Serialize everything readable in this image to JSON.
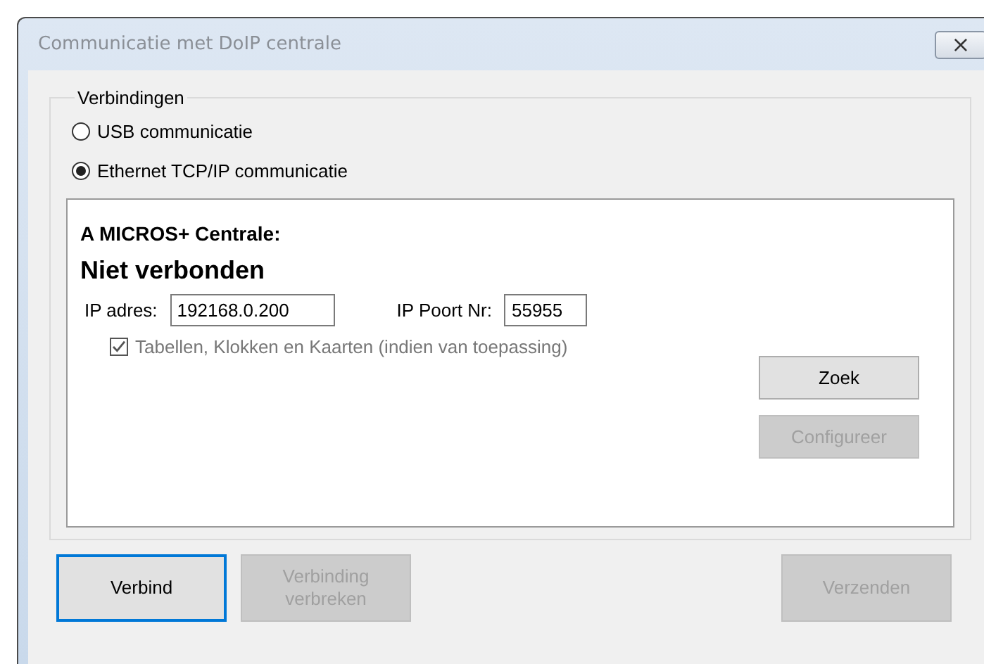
{
  "window": {
    "title": "Communicatie met DoIP centrale",
    "close": "×"
  },
  "group": {
    "title": "Verbindingen",
    "options": [
      {
        "label": "USB communicatie",
        "selected": false
      },
      {
        "label": "Ethernet TCP/IP communicatie",
        "selected": true
      }
    ],
    "panel": {
      "heading": "A MICROS+ Centrale:",
      "status": "Niet verbonden",
      "ip_label": "IP adres:",
      "ip_value": "192168.0.200",
      "port_label": "IP Poort Nr:",
      "port_value": "55955",
      "checkbox": {
        "label": "Tabellen, Klokken en Kaarten (indien van toepassing)",
        "checked": true,
        "disabled": true
      },
      "buttons": [
        {
          "label": "Zoek",
          "disabled": false
        },
        {
          "label": "Configureer",
          "disabled": true
        }
      ]
    }
  },
  "left_buttons": [
    {
      "label": "Verbind",
      "disabled": false,
      "focused": true
    },
    {
      "label": "Verbinding verbreken",
      "disabled": true,
      "focused": false
    }
  ],
  "right_buttons": [
    {
      "label": "Verzenden",
      "disabled": true,
      "focused": false
    }
  ]
}
